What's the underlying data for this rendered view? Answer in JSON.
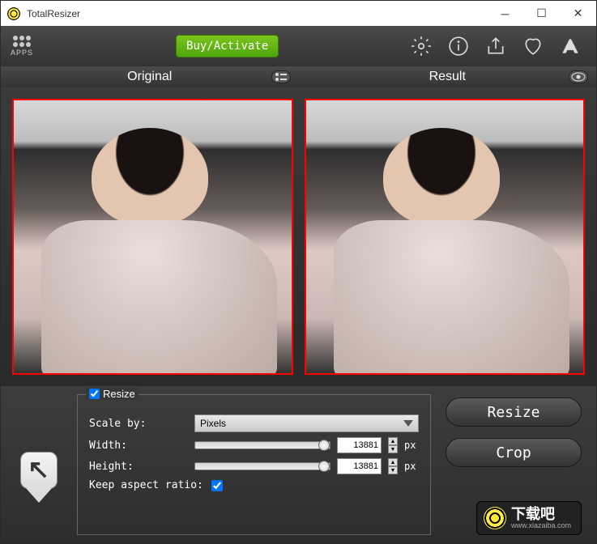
{
  "titlebar": {
    "app_name": "TotalResizer"
  },
  "toolbar": {
    "apps_label": "APPS",
    "buy_label": "Buy/Activate"
  },
  "panels": {
    "original_label": "Original",
    "result_label": "Result"
  },
  "resize": {
    "group_label": "Resize",
    "scale_by_label": "Scale by:",
    "scale_by_value": "Pixels",
    "width_label": "Width:",
    "width_value": "13881",
    "height_label": "Height:",
    "height_value": "13881",
    "px_unit": "px",
    "keep_ratio_label": "Keep aspect ratio:",
    "keep_ratio_checked": true,
    "enabled_checked": true
  },
  "actions": {
    "resize_label": "Resize",
    "crop_label": "Crop"
  },
  "watermark": {
    "main": "下载吧",
    "sub": "www.xiazaiba.com"
  }
}
